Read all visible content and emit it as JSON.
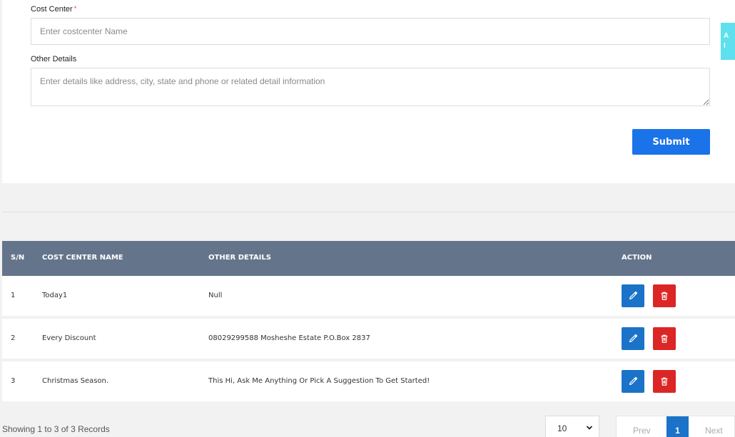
{
  "form": {
    "cost_center_label": "Cost Center",
    "required_mark": "*",
    "cost_center_placeholder": "Enter costcenter Name",
    "other_details_label": "Other Details",
    "other_details_placeholder": "Enter details like address, city, state and phone or related detail information",
    "submit_label": "Submit"
  },
  "side_tab": {
    "text": "A\nI"
  },
  "table": {
    "headers": {
      "sn": "S/N",
      "name": "COST CENTER NAME",
      "details": "OTHER DETAILS",
      "action": "ACTION"
    },
    "rows": [
      {
        "sn": "1",
        "name": "Today1",
        "details": "Null"
      },
      {
        "sn": "2",
        "name": "Every Discount",
        "details": "08029299588 Mosheshe Estate P.O.Box 2837"
      },
      {
        "sn": "3",
        "name": "Christmas Season.",
        "details": "This Hi, Ask Me Anything Or Pick A Suggestion To Get Started!"
      }
    ]
  },
  "footer": {
    "records_text": "Showing 1 to 3 of 3 Records",
    "page_size": "10",
    "prev_label": "Prev",
    "current_page": "1",
    "next_label": "Next"
  },
  "colors": {
    "primary": "#1a73e8",
    "table_header": "#64748b",
    "delete": "#dc2626",
    "side_tab": "#5ee0ee"
  },
  "icons": {
    "edit": "pencil-icon",
    "delete": "trash-icon",
    "select": "chevron-down-icon"
  }
}
